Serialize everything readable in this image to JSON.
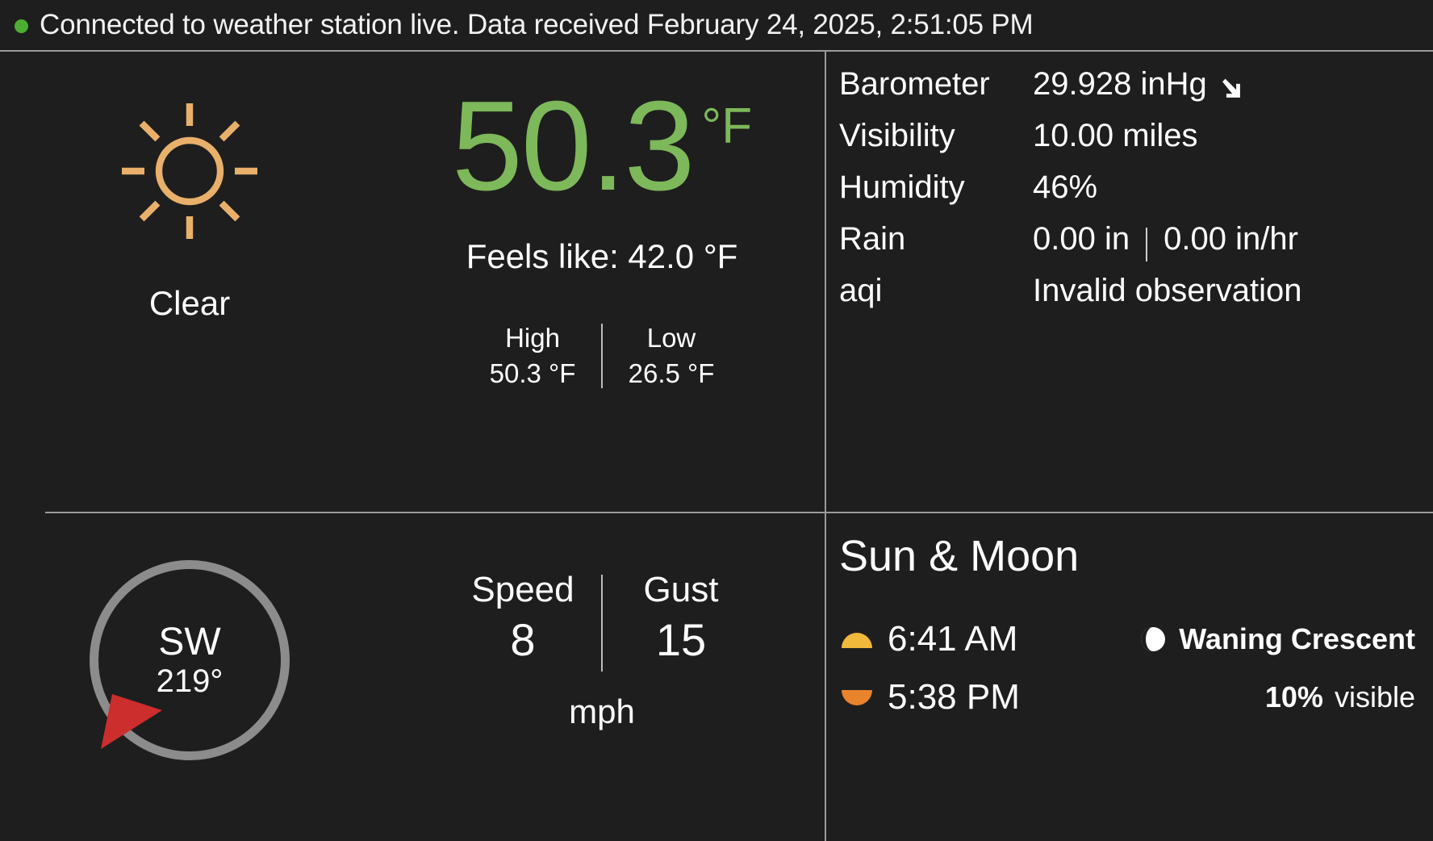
{
  "status": {
    "indicator_color": "#4caf32",
    "message": "Connected to weather station live. Data received February 24, 2025, 2:51:05 PM"
  },
  "current": {
    "condition_label": "Clear",
    "condition_icon": "sun-icon",
    "temperature": "50.3",
    "temperature_unit": "°F",
    "temperature_color": "#7db85a",
    "feels_like": "Feels like: 42.0 °F",
    "high_label": "High",
    "high_value": "50.3 °F",
    "low_label": "Low",
    "low_value": "26.5 °F"
  },
  "details": [
    {
      "key": "Barometer",
      "value": "29.928 inHg",
      "trend": "arrow-down-right-icon"
    },
    {
      "key": "Visibility",
      "value": "10.00 miles",
      "trend": ""
    },
    {
      "key": "Humidity",
      "value": "46%",
      "trend": ""
    },
    {
      "key": "Rain",
      "value": "0.00 in",
      "value2": "0.00 in/hr",
      "trend": ""
    },
    {
      "key": "aqi",
      "value": "Invalid observation",
      "trend": ""
    }
  ],
  "wind": {
    "direction_cardinal": "SW",
    "direction_degrees": "219°",
    "arrow_color": "#cc2d2d",
    "ring_color": "#8c8c8c",
    "speed_label": "Speed",
    "speed_value": "8",
    "gust_label": "Gust",
    "gust_value": "15",
    "unit": "mph"
  },
  "sun_moon": {
    "title": "Sun & Moon",
    "sunrise_time": "6:41 AM",
    "sunrise_icon": "sunrise-icon",
    "sunrise_color": "#f0b93c",
    "sunset_time": "5:38 PM",
    "sunset_icon": "sunset-icon",
    "sunset_color": "#e8842c",
    "moon_phase": "Waning Crescent",
    "moon_icon": "moon-waning-crescent-icon",
    "moon_visible_pct": "10%",
    "moon_visible_word": "visible"
  }
}
